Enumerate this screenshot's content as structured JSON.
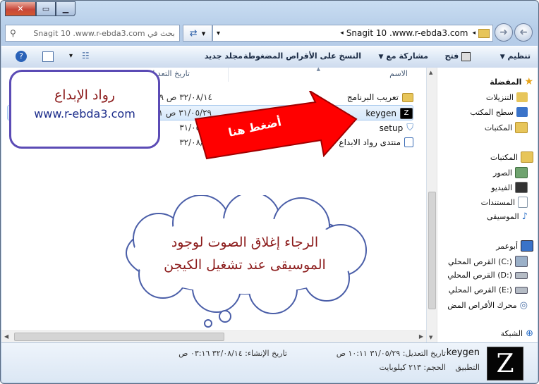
{
  "window": {
    "search_placeholder": "بحث في Snagit 10 .www.r-ebda3.com",
    "breadcrumb": [
      "Snagit 10 .www.r-ebda3.com"
    ]
  },
  "toolbar": {
    "organize": "تنظيم",
    "open": "فتح",
    "share_with": "مشاركة مع",
    "burn": "النسخ على الأقراص المضغوطة",
    "new_folder": "مجلد جديد"
  },
  "nav": {
    "favorites_header": "المفضلة",
    "favorites": [
      "التنزيلات",
      "سطح المكتب",
      "المكتبات"
    ],
    "libraries_header": "المكتبات",
    "libraries": [
      "الصور",
      "الفيديو",
      "المستندات",
      "الموسيقى"
    ],
    "computer_header": "أبوعمر",
    "drives": [
      "القرص المحلي (C:)",
      "القرص المحلي (D:)",
      "القرص المحلي (E:)",
      "محرك الأقراص المض"
    ],
    "network_header": "الشبكة"
  },
  "columns": {
    "name": "الاسم",
    "date": "تاريخ التعديل"
  },
  "files": [
    {
      "name": "تعريب البرنامج",
      "date": "٣٢/٠٨/١٤ ص ٠٣:٢٩",
      "icon": "folder-icon"
    },
    {
      "name": "keygen",
      "date": "٣١/٠٥/٢٩ ص ١٠:١١",
      "icon": "keygen-icon"
    },
    {
      "name": "setup",
      "date": "٣١/٠٥/٠٧",
      "icon": "setup-icon"
    },
    {
      "name": "منتدى رواد الابداع",
      "date": "٣٢/٠٨/٠٧",
      "icon": "shortcut-icon"
    }
  ],
  "overlay": {
    "brand_title": "رواد الإبداع",
    "brand_url": "www.r-ebda3.com",
    "arrow_text": "أضغط هنا",
    "cloud_line1": "الرجاء إغلاق الصوت لوجود",
    "cloud_line2": "الموسيقى عند تشغيل الكيجن"
  },
  "details": {
    "name": "keygen",
    "type": "التطبيق",
    "modified": "تاريخ التعديل: ٣١/٠٥/٢٩ ١٠:١١ ص",
    "size": "الحجم: ٢١٣ كيلوبايت",
    "created": "تاريخ الإنشاء: ٣٢/٠٨/١٤ ٠٣:١٦ ص"
  },
  "colors": {
    "accent": "#ff0000",
    "brand_border": "#5b4bb5",
    "cloud_text": "#8b1a1a"
  }
}
